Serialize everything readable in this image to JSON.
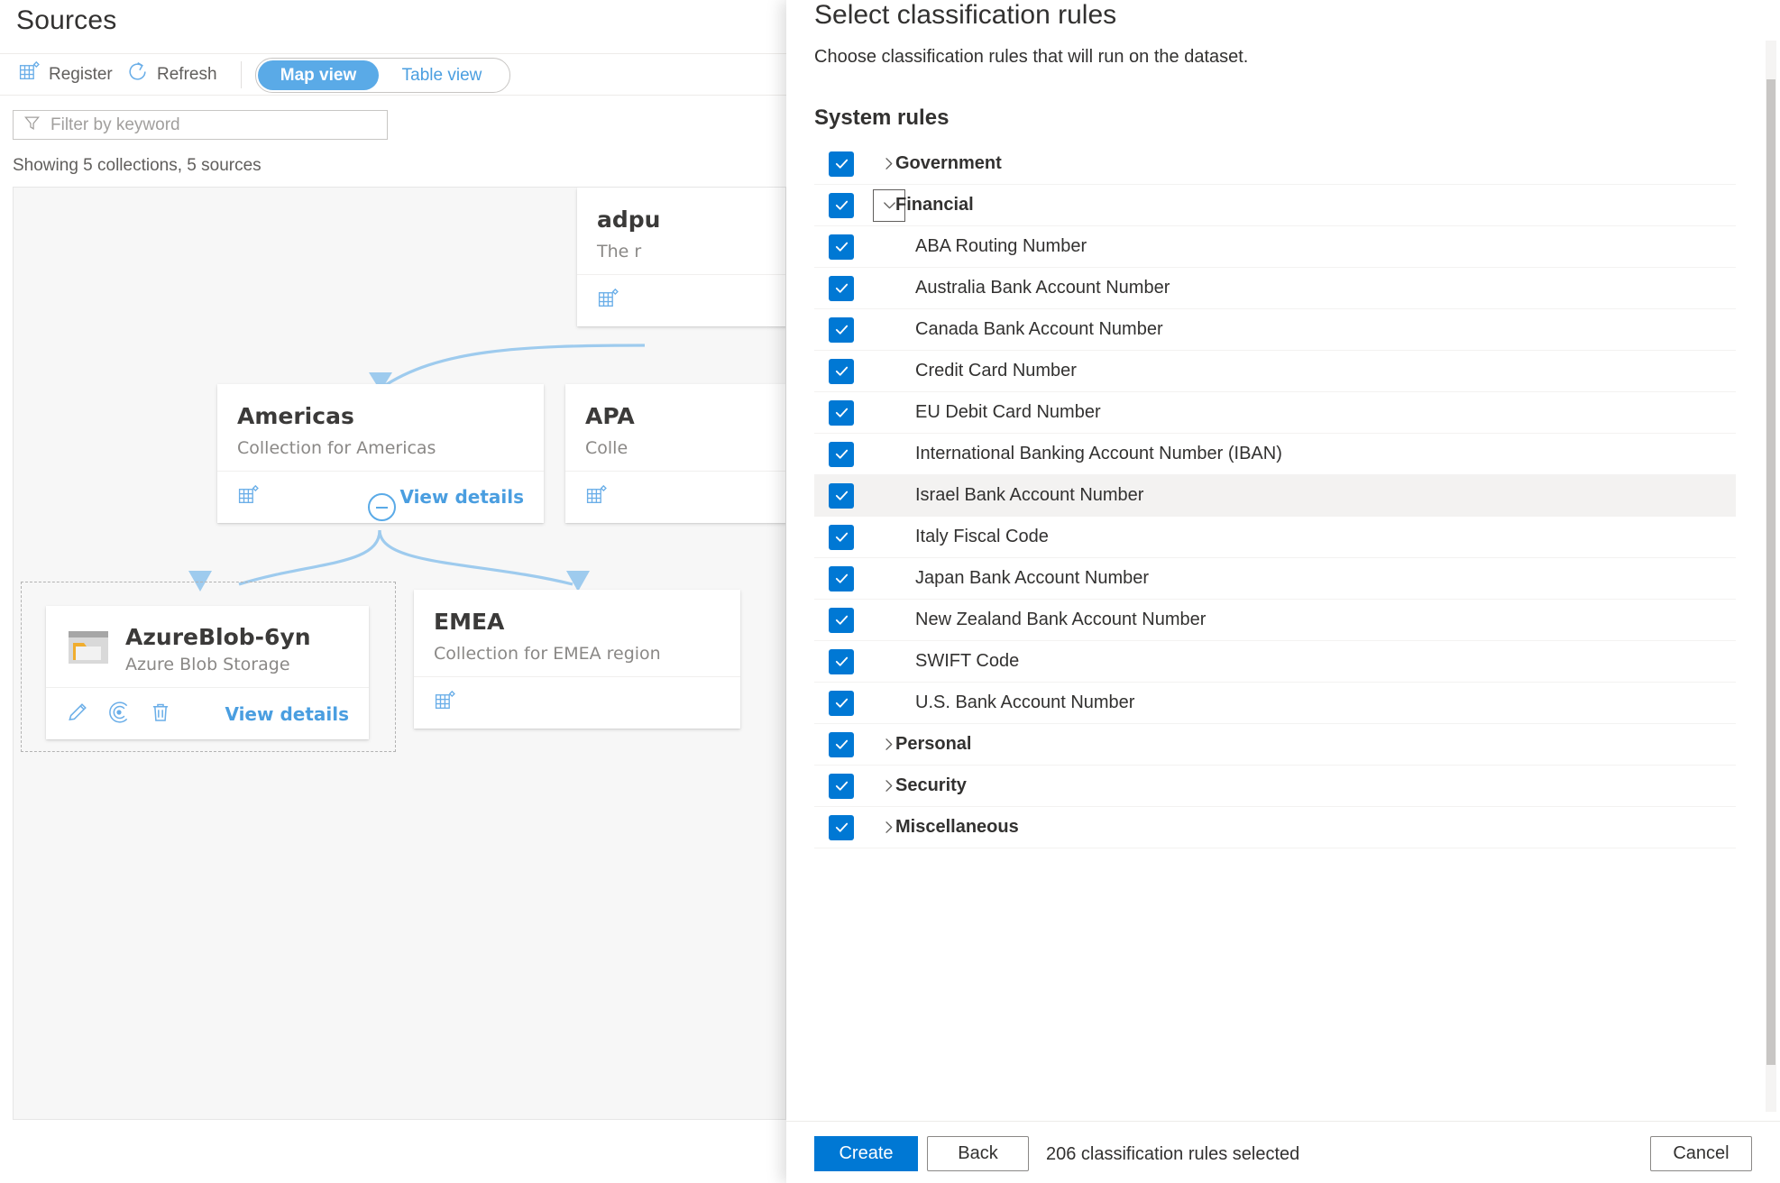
{
  "sources": {
    "title": "Sources",
    "toolbar": {
      "register_label": "Register",
      "register_icon": "register-grid-icon",
      "refresh_label": "Refresh",
      "refresh_icon": "refresh-icon",
      "pivot_map": "Map view",
      "pivot_table": "Table view"
    },
    "filter": {
      "placeholder": "Filter by keyword",
      "value": "",
      "icon": "filter-funnel-icon"
    },
    "showing": "Showing 5 collections, 5 sources",
    "cards": [
      {
        "id": "adpurview",
        "title": "adpu",
        "subtitle": "The r",
        "icon": "collection-grid-icon",
        "action": ""
      },
      {
        "id": "americas",
        "title": "Americas",
        "subtitle": "Collection for Americas",
        "icon": "collection-grid-icon",
        "action": "View details"
      },
      {
        "id": "apac",
        "title": "APA",
        "subtitle": "Colle",
        "icon": "collection-grid-icon",
        "action": ""
      },
      {
        "id": "emea",
        "title": "EMEA",
        "subtitle": "Collection for EMEA region",
        "icon": "collection-grid-icon",
        "action": ""
      }
    ],
    "source_card": {
      "title": "AzureBlob-6yn",
      "subtitle": "Azure Blob Storage",
      "icon": "azure-blob-folder-icon",
      "actions": [
        "edit-pencil-icon",
        "scan-radar-icon",
        "delete-trash-icon"
      ],
      "link": "View details"
    },
    "collapse_icon": "collapse-minus-icon"
  },
  "panel": {
    "title": "Select classification rules",
    "description": "Choose classification rules that will run on the dataset.",
    "section_heading": "System rules",
    "rules": [
      {
        "label": "Government",
        "level": "group",
        "checked": true,
        "expanded": false,
        "chevron": "chevron-right-icon",
        "hover": false,
        "focused": false
      },
      {
        "label": "Financial",
        "level": "group",
        "checked": true,
        "expanded": true,
        "chevron": "chevron-down-icon",
        "hover": false,
        "focused": true
      },
      {
        "label": "ABA Routing Number",
        "level": "child",
        "checked": true,
        "hover": false
      },
      {
        "label": "Australia Bank Account Number",
        "level": "child",
        "checked": true,
        "hover": false
      },
      {
        "label": "Canada Bank Account Number",
        "level": "child",
        "checked": true,
        "hover": false
      },
      {
        "label": "Credit Card Number",
        "level": "child",
        "checked": true,
        "hover": false
      },
      {
        "label": "EU Debit Card Number",
        "level": "child",
        "checked": true,
        "hover": false
      },
      {
        "label": "International Banking Account Number (IBAN)",
        "level": "child",
        "checked": true,
        "hover": false
      },
      {
        "label": "Israel Bank Account Number",
        "level": "child",
        "checked": true,
        "hover": true
      },
      {
        "label": "Italy Fiscal Code",
        "level": "child",
        "checked": true,
        "hover": false
      },
      {
        "label": "Japan Bank Account Number",
        "level": "child",
        "checked": true,
        "hover": false
      },
      {
        "label": "New Zealand Bank Account Number",
        "level": "child",
        "checked": true,
        "hover": false
      },
      {
        "label": "SWIFT Code",
        "level": "child",
        "checked": true,
        "hover": false
      },
      {
        "label": "U.S. Bank Account Number",
        "level": "child",
        "checked": true,
        "hover": false
      },
      {
        "label": "Personal",
        "level": "group",
        "checked": true,
        "expanded": false,
        "chevron": "chevron-right-icon",
        "hover": false,
        "focused": false
      },
      {
        "label": "Security",
        "level": "group",
        "checked": true,
        "expanded": false,
        "chevron": "chevron-right-icon",
        "hover": false,
        "focused": false
      },
      {
        "label": "Miscellaneous",
        "level": "group",
        "checked": true,
        "expanded": false,
        "chevron": "chevron-right-icon",
        "hover": false,
        "focused": false
      }
    ],
    "footer": {
      "create_label": "Create",
      "back_label": "Back",
      "status": "206 classification rules selected",
      "cancel_label": "Cancel"
    }
  },
  "colors": {
    "accent": "#0078d4",
    "link": "#4a9ee0",
    "pivot_active": "#5aaae7",
    "connector": "#9ecbee",
    "text": "#323130",
    "muted": "#8a8886"
  }
}
